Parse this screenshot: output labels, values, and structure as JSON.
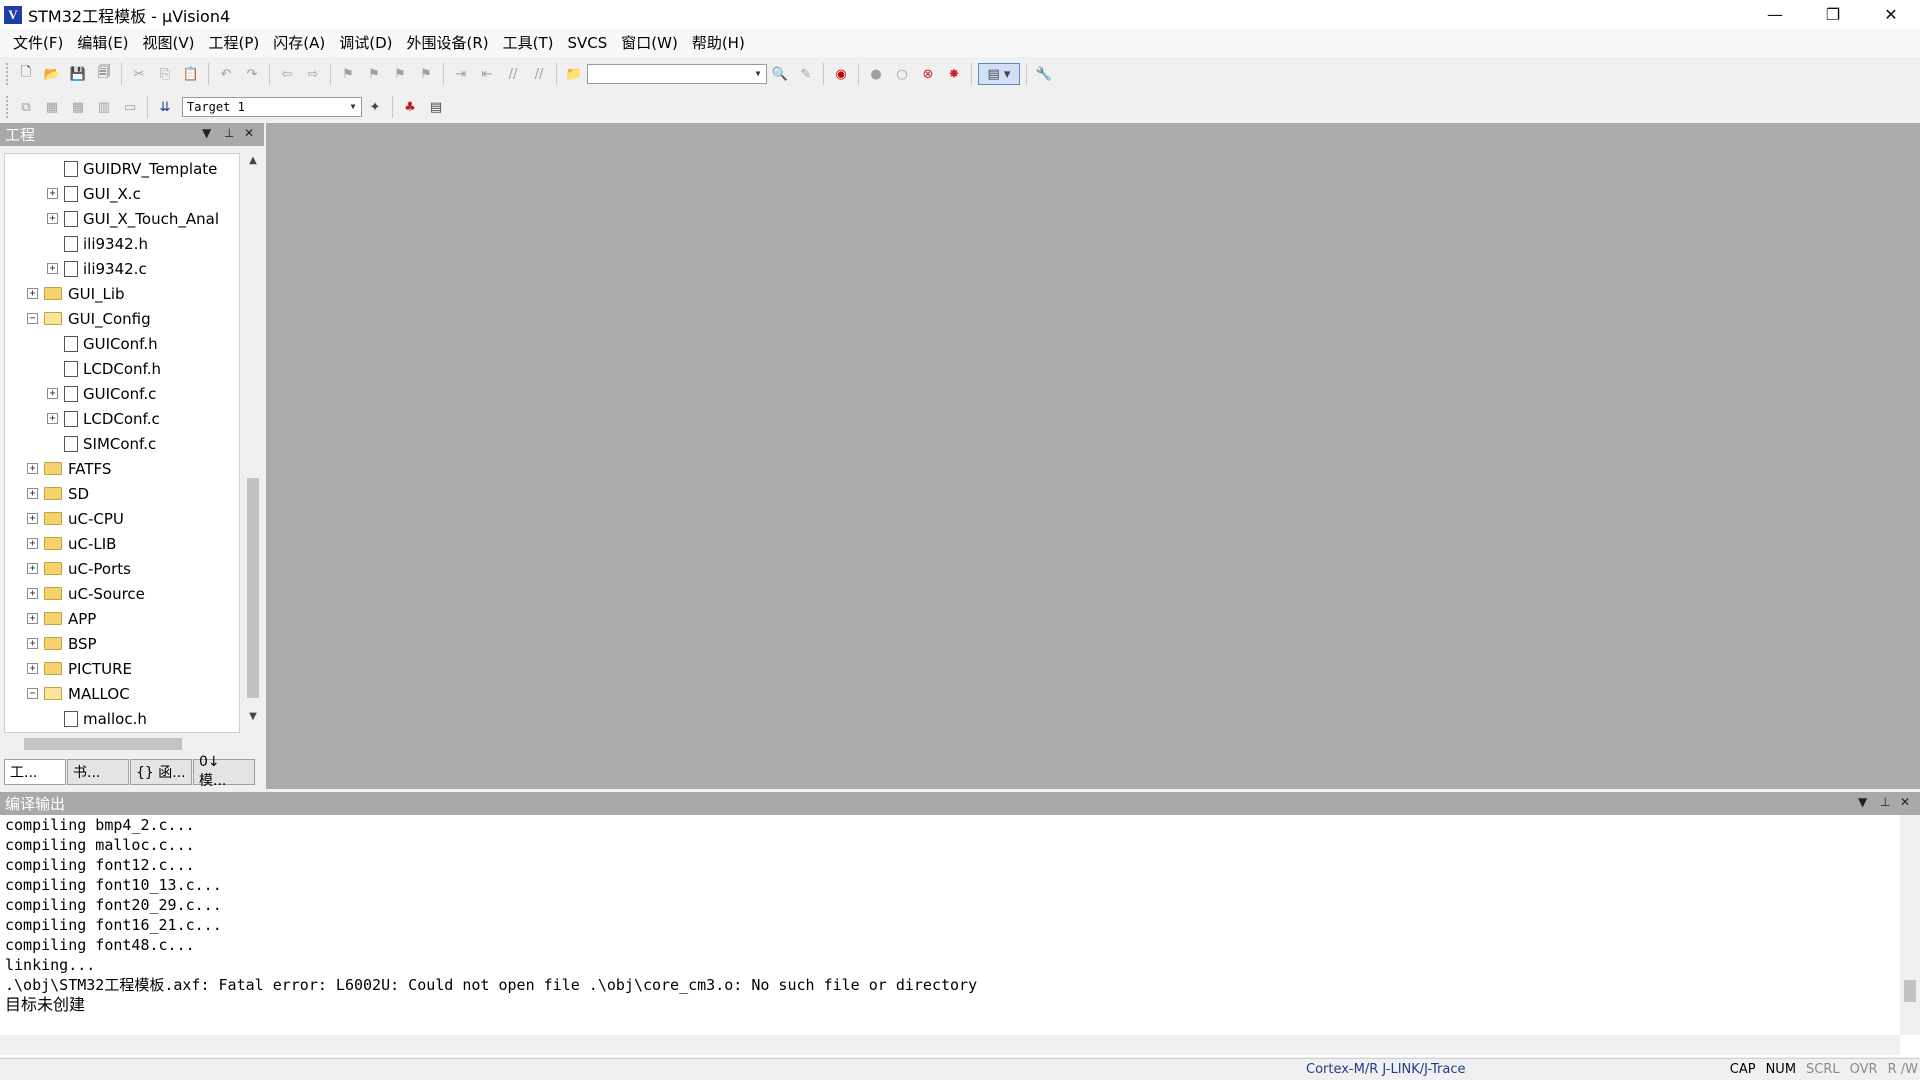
{
  "window": {
    "title": "STM32工程模板 - μVision4",
    "icon_letter": "V",
    "controls": [
      "—",
      "❐",
      "✕"
    ]
  },
  "menu": [
    "文件(F)",
    "编辑(E)",
    "视图(V)",
    "工程(P)",
    "闪存(A)",
    "调试(D)",
    "外围设备(R)",
    "工具(T)",
    "SVCS",
    "窗口(W)",
    "帮助(H)"
  ],
  "toolbar2": {
    "target_select": "Target 1"
  },
  "project_panel": {
    "title": "工程",
    "tree": [
      {
        "label": "GUIDRV_Template",
        "type": "file",
        "expander": "",
        "level": 2
      },
      {
        "label": "GUI_X.c",
        "type": "file",
        "expander": "+",
        "level": 2
      },
      {
        "label": "GUI_X_Touch_Anal",
        "type": "file",
        "expander": "+",
        "level": 2
      },
      {
        "label": "ili9342.h",
        "type": "file",
        "expander": "",
        "level": 2
      },
      {
        "label": "ili9342.c",
        "type": "file",
        "expander": "+",
        "level": 2
      },
      {
        "label": "GUI_Lib",
        "type": "folder",
        "expander": "+",
        "level": 1
      },
      {
        "label": "GUI_Config",
        "type": "folder-open",
        "expander": "−",
        "level": 1
      },
      {
        "label": "GUIConf.h",
        "type": "file",
        "expander": "",
        "level": 2
      },
      {
        "label": "LCDConf.h",
        "type": "file",
        "expander": "",
        "level": 2
      },
      {
        "label": "GUIConf.c",
        "type": "file",
        "expander": "+",
        "level": 2
      },
      {
        "label": "LCDConf.c",
        "type": "file",
        "expander": "+",
        "level": 2
      },
      {
        "label": "SIMConf.c",
        "type": "file",
        "expander": "",
        "level": 2
      },
      {
        "label": "FATFS",
        "type": "folder",
        "expander": "+",
        "level": 1
      },
      {
        "label": "SD",
        "type": "folder",
        "expander": "+",
        "level": 1
      },
      {
        "label": "uC-CPU",
        "type": "folder",
        "expander": "+",
        "level": 1
      },
      {
        "label": "uC-LIB",
        "type": "folder",
        "expander": "+",
        "level": 1
      },
      {
        "label": "uC-Ports",
        "type": "folder",
        "expander": "+",
        "level": 1
      },
      {
        "label": "uC-Source",
        "type": "folder",
        "expander": "+",
        "level": 1
      },
      {
        "label": "APP",
        "type": "folder",
        "expander": "+",
        "level": 1
      },
      {
        "label": "BSP",
        "type": "folder",
        "expander": "+",
        "level": 1
      },
      {
        "label": "PICTURE",
        "type": "folder",
        "expander": "+",
        "level": 1
      },
      {
        "label": "MALLOC",
        "type": "folder-open",
        "expander": "−",
        "level": 1
      },
      {
        "label": "malloc.h",
        "type": "file",
        "expander": "",
        "level": 2
      }
    ],
    "tabs": [
      "工...",
      "书...",
      "{} 函...",
      "0↓ 模..."
    ]
  },
  "build_output": {
    "title": "编译输出",
    "lines": [
      "compiling bmp4_2.c...",
      "compiling malloc.c...",
      "compiling font12.c...",
      "compiling font10_13.c...",
      "compiling font20_29.c...",
      "compiling font16_21.c...",
      "compiling font48.c...",
      "linking...",
      ".\\obj\\STM32工程模板.axf: Fatal error: L6002U: Could not open file .\\obj\\core_cm3.o: No such file or directory",
      "目标未创建"
    ]
  },
  "status": {
    "debugger": "Cortex-M/R J-LINK/J-Trace",
    "keys": [
      {
        "label": "CAP",
        "active": true
      },
      {
        "label": "NUM",
        "active": true
      },
      {
        "label": "SCRL",
        "active": false
      },
      {
        "label": "OVR",
        "active": false
      },
      {
        "label": "R /W",
        "active": false
      }
    ]
  }
}
